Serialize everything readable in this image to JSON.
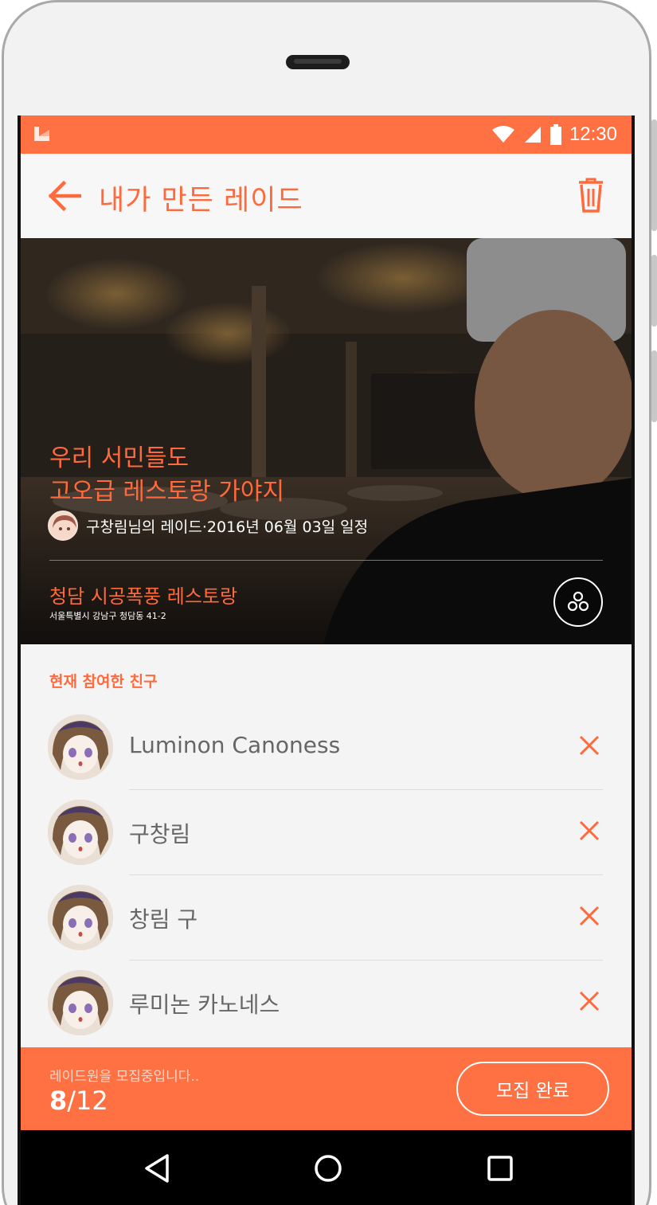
{
  "status_bar": {
    "time": "12:30",
    "icons": [
      "app-logo-icon",
      "wifi-icon",
      "signal-icon",
      "battery-icon"
    ],
    "color": "#ff7043"
  },
  "app_bar": {
    "title": "내가 만든 레이드",
    "back_icon": "arrow-left-icon",
    "delete_icon": "trash-icon"
  },
  "hero": {
    "title_line1": "우리 서민들도",
    "title_line2": "고오급 레스토랑 가야지",
    "meta": "구창림님의 레이드·2016년 06월 03일 일정",
    "place_name": "청담 시공폭풍 레스토랑",
    "place_address": "서울특별시 강남구 청담동 41-2",
    "share_icon": "share-icon"
  },
  "friends": {
    "section_label": "현재 참여한 친구",
    "items": [
      {
        "name": "Luminon Canoness"
      },
      {
        "name": "구창림"
      },
      {
        "name": "창림 구"
      },
      {
        "name": "루미논 카노네스"
      }
    ]
  },
  "bottom_bar": {
    "recruit_text": "레이드원을 모집중입니다..",
    "current": "8",
    "total": "/12",
    "complete_label": "모집 완료"
  },
  "nav_bar": {
    "icons": [
      "back-triangle-icon",
      "home-circle-icon",
      "recents-square-icon"
    ]
  },
  "accent_color": "#ff6a3d"
}
